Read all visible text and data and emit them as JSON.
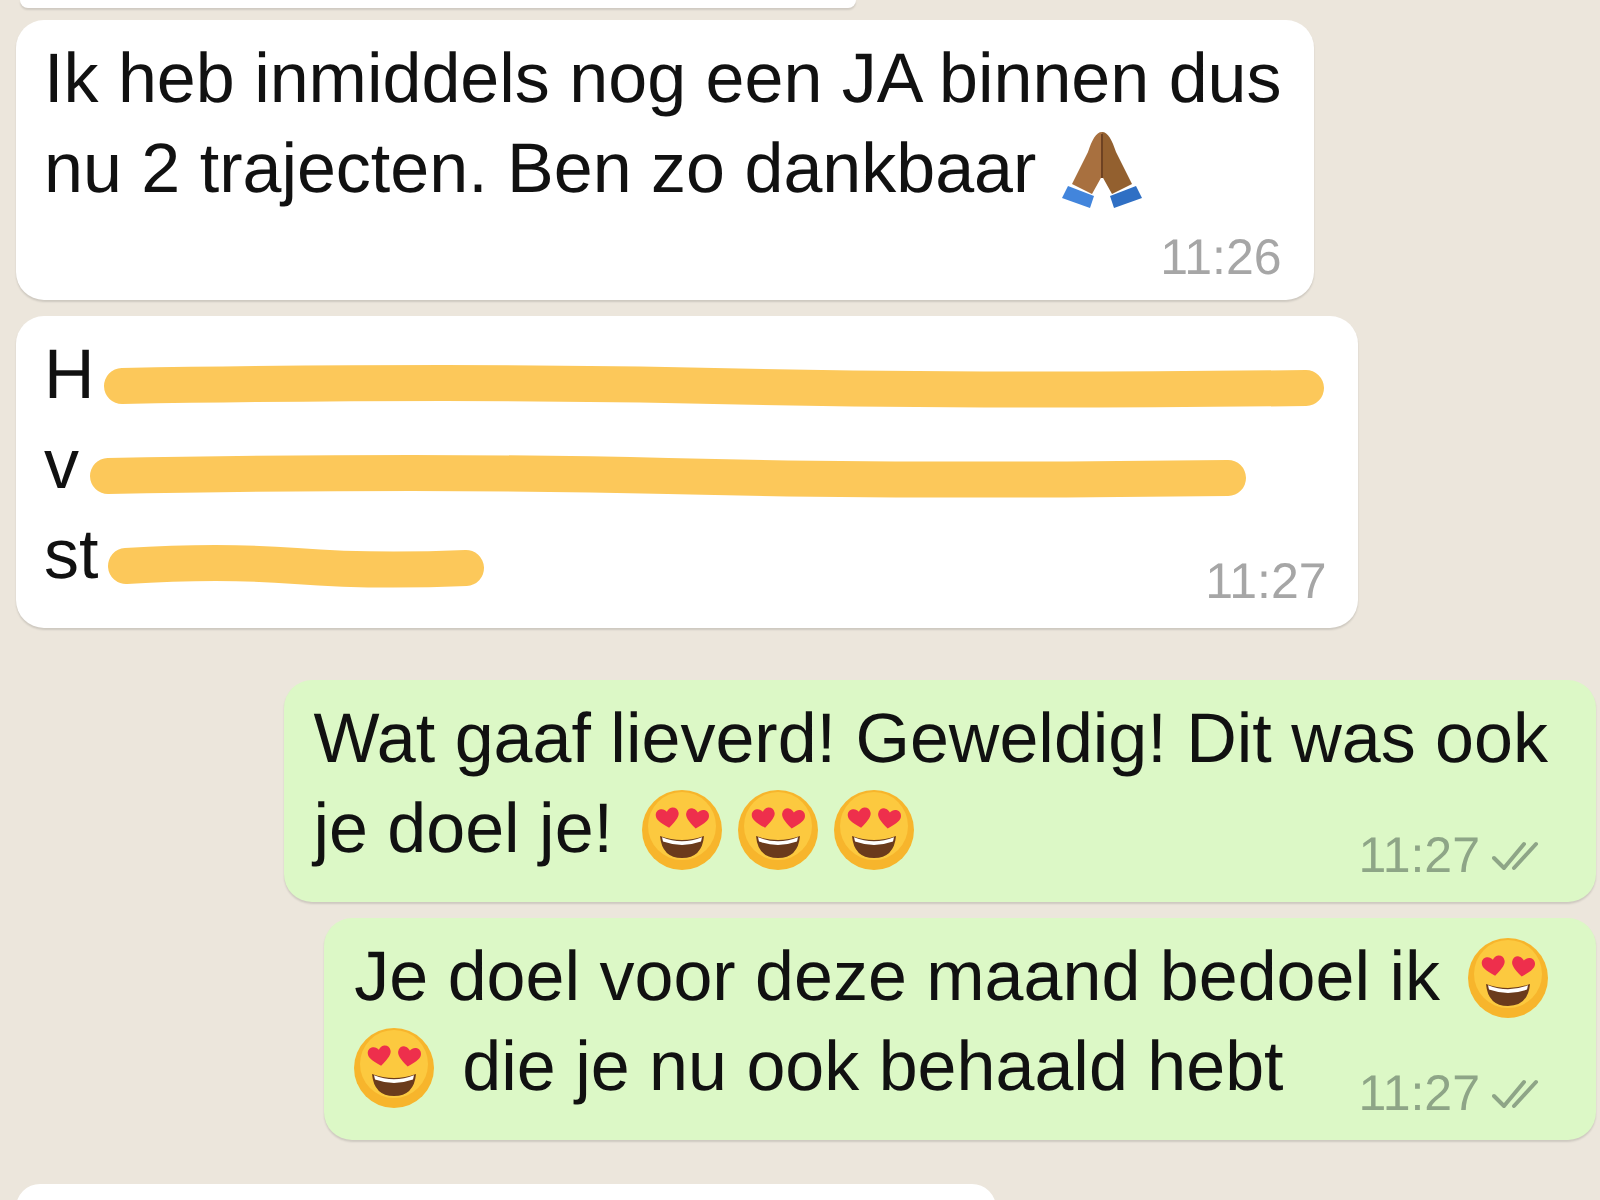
{
  "messages": [
    {
      "kind": "incoming",
      "lines": [
        [
          {
            "kind": "text",
            "text": "Ik heb inmiddels nog een JA binnen dus"
          }
        ],
        [
          {
            "kind": "text",
            "text": "nu 2 trajecten. Ben zo dankbaar"
          },
          {
            "kind": "praying_hands"
          }
        ]
      ],
      "time": "11:26"
    },
    {
      "kind": "incoming",
      "lines": [
        [
          {
            "kind": "text",
            "text": "H"
          },
          {
            "kind": "scribble"
          }
        ],
        [
          {
            "kind": "text",
            "text": "v"
          },
          {
            "kind": "scribble"
          }
        ],
        [
          {
            "kind": "text",
            "text": "st"
          },
          {
            "kind": "scribble"
          }
        ]
      ],
      "time": "11:27"
    },
    {
      "kind": "outgoing",
      "lines": [
        [
          {
            "kind": "text",
            "text": "Wat gaaf lieverd! Geweldig! Dit was ook"
          }
        ],
        [
          {
            "kind": "text",
            "text": "je doel je!"
          },
          {
            "kind": "heart_eyes"
          },
          {
            "kind": "heart_eyes"
          },
          {
            "kind": "heart_eyes"
          }
        ]
      ],
      "time": "11:27",
      "double_tick": true
    },
    {
      "kind": "outgoing",
      "lines": [
        [
          {
            "kind": "text",
            "text": "Je doel voor deze maand bedoel ik"
          },
          {
            "kind": "heart_eyes"
          }
        ],
        [
          {
            "kind": "heart_eyes"
          },
          {
            "kind": "text",
            "text": "die je nu ook behaald hebt"
          }
        ]
      ],
      "time": "11:27",
      "double_tick": true
    }
  ]
}
